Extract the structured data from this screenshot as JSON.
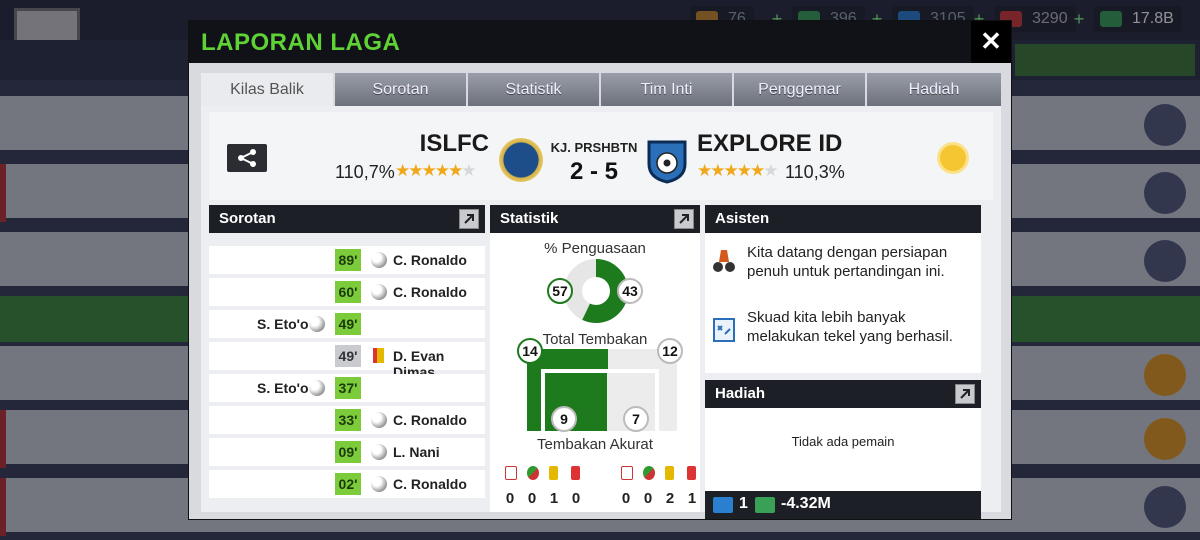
{
  "background": {
    "resources": [
      {
        "value": "76",
        "color": "#c98a2a"
      },
      {
        "value": "396",
        "color": "#3aa055"
      },
      {
        "value": "3105",
        "color": "#2a7fd0"
      },
      {
        "value": "3290",
        "color": "#d03a3a"
      },
      {
        "value": "17.8B",
        "color": "#3aa055"
      }
    ]
  },
  "modal": {
    "title": "LAPORAN LAGA",
    "close_label": "✕",
    "tabs": [
      "Kilas Balik",
      "Sorotan",
      "Statistik",
      "Tim Inti",
      "Penggemar",
      "Hadiah"
    ],
    "active_tab": "Kilas Balik"
  },
  "match": {
    "home_team": "ISLFC",
    "home_rating": "110,7%",
    "score_label": "KJ. PRSHBTN",
    "score": "2 - 5",
    "away_team": "EXPLORE ID",
    "away_rating": "110,3%",
    "weather_icon": "sun-icon"
  },
  "highlights": {
    "title": "Sorotan",
    "events": [
      {
        "minute": "89'",
        "side": "away",
        "type": "goal",
        "player": "C. Ronaldo"
      },
      {
        "minute": "60'",
        "side": "away",
        "type": "goal",
        "player": "C. Ronaldo"
      },
      {
        "minute": "49'",
        "side": "home",
        "type": "goal",
        "player": "S. Eto'o"
      },
      {
        "minute": "49'",
        "side": "away",
        "type": "yellow-card",
        "player": "D. Evan Dimas"
      },
      {
        "minute": "37'",
        "side": "home",
        "type": "goal",
        "player": "S. Eto'o"
      },
      {
        "minute": "33'",
        "side": "away",
        "type": "goal",
        "player": "C. Ronaldo"
      },
      {
        "minute": "09'",
        "side": "away",
        "type": "goal",
        "player": "L. Nani"
      },
      {
        "minute": "02'",
        "side": "away",
        "type": "goal",
        "player": "C. Ronaldo"
      }
    ]
  },
  "stats": {
    "title": "Statistik",
    "possession_label": "% Penguasaan",
    "possession_home": "57",
    "possession_away": "43",
    "shots_label": "Total Tembakan",
    "shots_home": "14",
    "shots_away": "12",
    "accurate_label": "Tembakan Akurat",
    "accurate_home": "9",
    "accurate_away": "7",
    "discipline_home": [
      "0",
      "0",
      "1",
      "0"
    ],
    "discipline_away": [
      "0",
      "0",
      "2",
      "1"
    ]
  },
  "assistant": {
    "title": "Asisten",
    "messages": [
      "Kita datang dengan persiapan penuh untuk pertandingan ini.",
      "Skuad kita lebih banyak melakukan tekel yang berhasil."
    ]
  },
  "rewards": {
    "title": "Hadiah",
    "no_player": "Tidak ada pemain",
    "energy": "1",
    "money": "-4.32M"
  },
  "colors": {
    "accent_green": "#5fd235",
    "minute_green": "#7ccb3a",
    "possession_green": "#1d7a1d"
  }
}
